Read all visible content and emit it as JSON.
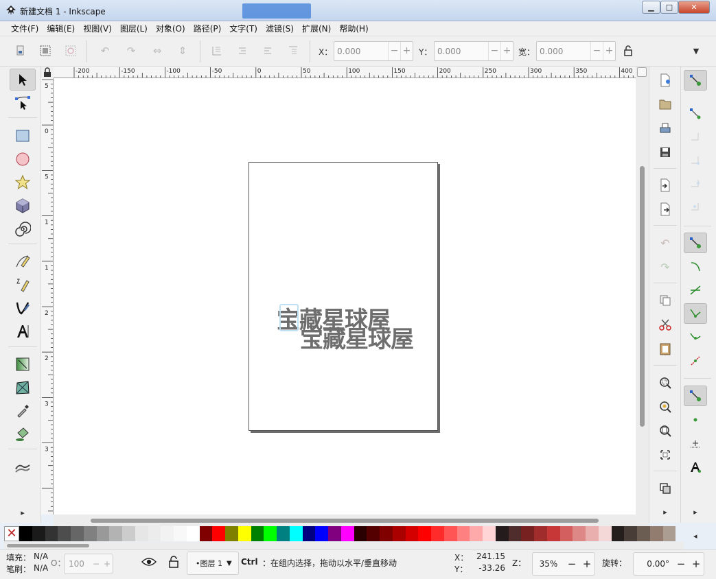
{
  "window": {
    "title": "新建文档 1 - Inkscape",
    "minimize_glyph": "▁",
    "maximize_glyph": "□",
    "close_glyph": "✕"
  },
  "menu": [
    "文件(F)",
    "编辑(E)",
    "视图(V)",
    "图层(L)",
    "对象(O)",
    "路径(P)",
    "文字(T)",
    "滤镜(S)",
    "扩展(N)",
    "帮助(H)"
  ],
  "toolbar": {
    "x_label": "X：",
    "x_value": "0.000",
    "y_label": "Y：",
    "y_value": "0.000",
    "w_label": "宽：",
    "w_value": "0.000",
    "minus": "−",
    "plus": "+",
    "overflow": "▼"
  },
  "ruler": {
    "top_labels": [
      "-200",
      "-150",
      "-100",
      "-50",
      "0",
      "50",
      "100",
      "150",
      "200",
      "250",
      "300",
      "350",
      "400"
    ],
    "left_labels": [
      "5",
      "0",
      "5",
      "1",
      "1",
      "2",
      "2",
      "3",
      "3"
    ]
  },
  "canvas": {
    "text_line_1": "宝藏星球屋",
    "text_line_2": "宝藏星球屋"
  },
  "toolbox": {
    "expand_glyph": "▸"
  },
  "right_panels": {
    "cmd_expand": "▸",
    "snap_expand": "▸",
    "snap_left": "◂"
  },
  "palette": {
    "none_label": "✕",
    "colors": [
      "#000000",
      "#1a1a1a",
      "#333333",
      "#4d4d4d",
      "#666666",
      "#808080",
      "#999999",
      "#b3b3b3",
      "#cccccc",
      "#e6e6e6",
      "#ececec",
      "#f2f2f2",
      "#f8f8f8",
      "#ffffff",
      "#800000",
      "#ff0000",
      "#808000",
      "#ffff00",
      "#008000",
      "#00ff00",
      "#008080",
      "#00ffff",
      "#000080",
      "#0000ff",
      "#800080",
      "#ff00ff",
      "#2b0000",
      "#550000",
      "#800000",
      "#aa0000",
      "#d40000",
      "#ff0000",
      "#ff2a2a",
      "#ff5555",
      "#ff8080",
      "#ffaaaa",
      "#ffd5d5",
      "#241c1c",
      "#502d2d",
      "#782121",
      "#a02c2c",
      "#c83737",
      "#d35f5f",
      "#de8787",
      "#e9afaf",
      "#f4d7d7",
      "#241f1c",
      "#483e37",
      "#6c5d53",
      "#917c6f",
      "#ac9d93"
    ]
  },
  "status": {
    "fill_label": "填充：",
    "fill_value": "N/A",
    "stroke_label": "笔刷：",
    "stroke_value": "N/A",
    "opacity_label": "O：",
    "opacity_value": "100",
    "layer_name": "•图层 1",
    "message_bold": "Ctrl",
    "message": "：在组内选择，拖动以水平/垂直移动",
    "x_label": "X：",
    "x_value": "241.15",
    "y_label": "Y：",
    "y_value": "-33.26",
    "zoom_label": "Z：",
    "zoom_value": "35%",
    "rotate_label": "旋转：",
    "rotate_value": "0.00°",
    "minus": "−",
    "plus": "+"
  }
}
